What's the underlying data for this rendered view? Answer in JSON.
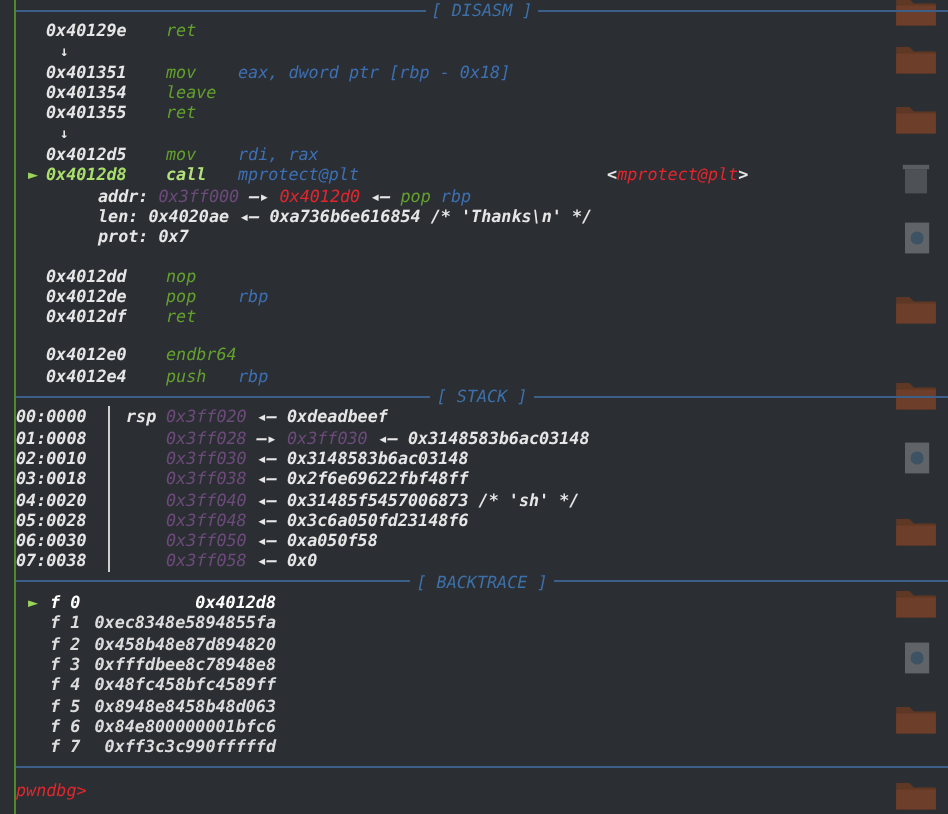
{
  "disasm": {
    "title": "[ DISASM ]",
    "lines": [
      {
        "kind": "instr",
        "address": "0x40129e",
        "mnemonic": "ret",
        "current": false
      },
      {
        "kind": "jump",
        "text": "↓"
      },
      {
        "kind": "instr",
        "address": "0x401351",
        "mnemonic": "mov",
        "operands": "eax, dword ptr [rbp - 0x18]",
        "current": false
      },
      {
        "kind": "instr",
        "address": "0x401354",
        "mnemonic": "leave",
        "current": false
      },
      {
        "kind": "instr",
        "address": "0x401355",
        "mnemonic": "ret",
        "current": false
      },
      {
        "kind": "jump",
        "text": "↓"
      },
      {
        "kind": "instr",
        "address": "0x4012d5",
        "mnemonic": "mov",
        "operands": "rdi, rax",
        "current": false
      },
      {
        "kind": "instr",
        "address": "0x4012d8",
        "mnemonic": "call",
        "operands": "mprotect@plt",
        "current": true,
        "marker": "►",
        "target": [
          {
            "text": "<",
            "kind": "plain"
          },
          {
            "text": "mprotect@plt",
            "kind": "code"
          },
          {
            "text": ">",
            "kind": "plain"
          }
        ]
      },
      {
        "kind": "arg",
        "name": "addr:",
        "value": [
          {
            "text": "0x3ff000",
            "kind": "stack"
          },
          {
            "text": "—▸",
            "kind": "plain"
          },
          {
            "text": "0x4012d0",
            "kind": "code"
          },
          {
            "text": "◂—",
            "kind": "plain"
          },
          {
            "text": "pop",
            "kind": "mnemonic"
          },
          {
            "text": "rbp",
            "kind": "reg"
          }
        ]
      },
      {
        "kind": "arg",
        "name": "len:",
        "value": [
          {
            "text": "0x4020ae ◂— 0xa736b6e616854 /* 'Thanks\\n' */",
            "kind": "plain"
          }
        ]
      },
      {
        "kind": "arg",
        "name": "prot:",
        "value": [
          {
            "text": "0x7",
            "kind": "plain"
          }
        ]
      },
      {
        "kind": "gap"
      },
      {
        "kind": "instr",
        "address": "0x4012dd",
        "mnemonic": "nop",
        "current": false
      },
      {
        "kind": "instr",
        "address": "0x4012de",
        "mnemonic": "pop",
        "operands": "rbp",
        "current": false
      },
      {
        "kind": "instr",
        "address": "0x4012df",
        "mnemonic": "ret",
        "current": false
      },
      {
        "kind": "gap"
      },
      {
        "kind": "instr",
        "address": "0x4012e0",
        "mnemonic": "endbr64",
        "current": false
      },
      {
        "kind": "instr",
        "address": "0x4012e4",
        "mnemonic": "push",
        "operands": "rbp",
        "current": false
      }
    ]
  },
  "stack": {
    "title": "[ STACK ]",
    "rows": [
      {
        "offset": "00:0000",
        "register": "rsp",
        "chain": [
          {
            "text": "0x3ff020",
            "kind": "stack"
          },
          {
            "text": "◂— 0xdeadbeef",
            "kind": "plain"
          }
        ]
      },
      {
        "offset": "01:0008",
        "chain": [
          {
            "text": "0x3ff028",
            "kind": "stack"
          },
          {
            "text": "—▸",
            "kind": "plain"
          },
          {
            "text": "0x3ff030",
            "kind": "stack"
          },
          {
            "text": "◂— 0x3148583b6ac03148",
            "kind": "plain"
          }
        ]
      },
      {
        "offset": "02:0010",
        "chain": [
          {
            "text": "0x3ff030",
            "kind": "stack"
          },
          {
            "text": "◂— 0x3148583b6ac03148",
            "kind": "plain"
          }
        ]
      },
      {
        "offset": "03:0018",
        "chain": [
          {
            "text": "0x3ff038",
            "kind": "stack"
          },
          {
            "text": "◂— 0x2f6e69622fbf48ff",
            "kind": "plain"
          }
        ]
      },
      {
        "offset": "04:0020",
        "chain": [
          {
            "text": "0x3ff040",
            "kind": "stack"
          },
          {
            "text": "◂— 0x31485f5457006873 /* 'sh' */",
            "kind": "plain"
          }
        ]
      },
      {
        "offset": "05:0028",
        "chain": [
          {
            "text": "0x3ff048",
            "kind": "stack"
          },
          {
            "text": "◂— 0x3c6a050fd23148f6",
            "kind": "plain"
          }
        ]
      },
      {
        "offset": "06:0030",
        "chain": [
          {
            "text": "0x3ff050",
            "kind": "stack"
          },
          {
            "text": "◂— 0xa050f58",
            "kind": "plain"
          }
        ]
      },
      {
        "offset": "07:0038",
        "chain": [
          {
            "text": "0x3ff058",
            "kind": "stack"
          },
          {
            "text": "◂— 0x0",
            "kind": "plain"
          }
        ]
      }
    ]
  },
  "backtrace": {
    "title": "[ BACKTRACE ]",
    "frames": [
      {
        "frame": "f 0",
        "address": "0x4012d8",
        "selected": true,
        "marker": "►"
      },
      {
        "frame": "f 1",
        "address": "0xec8348e5894855fa",
        "selected": false
      },
      {
        "frame": "f 2",
        "address": "0x458b48e87d894820",
        "selected": false
      },
      {
        "frame": "f 3",
        "address": "0xfffdbee8c78948e8",
        "selected": false
      },
      {
        "frame": "f 4",
        "address": "0x48fc458bfc4589ff",
        "selected": false
      },
      {
        "frame": "f 5",
        "address": "0x8948e8458b48d063",
        "selected": false
      },
      {
        "frame": "f 6",
        "address": "0x84e800000001bfc6",
        "selected": false
      },
      {
        "frame": "f 7",
        "address": "0xff3c3c990fffffd",
        "selected": false
      }
    ]
  },
  "prompt": "pwndbg>"
}
